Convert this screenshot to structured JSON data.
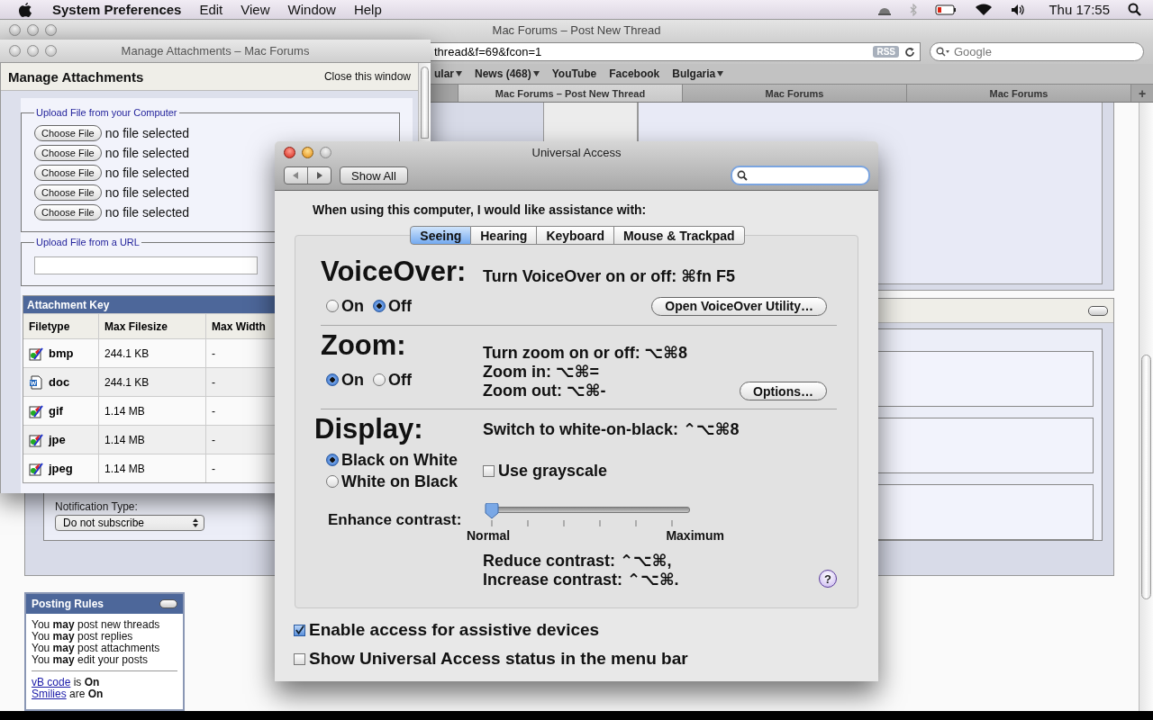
{
  "menu_bar": {
    "app_name": "System Preferences",
    "menus": [
      "Edit",
      "View",
      "Window",
      "Help"
    ],
    "clock": "Thu 17:55"
  },
  "browser": {
    "title": "Mac Forums – Post New Thread",
    "url": "thread&f=69&fcon=1",
    "rss": "RSS",
    "search_placeholder": "Google",
    "bookmarks": [
      {
        "label": "ular",
        "menu": true
      },
      {
        "label": "News (468)",
        "menu": true
      },
      {
        "label": "YouTube",
        "menu": false
      },
      {
        "label": "Facebook",
        "menu": false
      },
      {
        "label": "Bulgaria",
        "menu": true
      }
    ],
    "tabs": [
      {
        "label": "Mac Forums – Post New Thread",
        "selected": true
      },
      {
        "label": "Mac Forums",
        "selected": false
      },
      {
        "label": "Mac Forums",
        "selected": false
      }
    ],
    "new_tab": "+"
  },
  "forum_page": {
    "notification": {
      "label": "Notification Type:",
      "value": "Do not subscribe"
    },
    "posting_rules": {
      "title": "Posting Rules",
      "rules": [
        "You **may** post new threads",
        "You **may** post replies",
        "You **may** post attachments",
        "You **may** edit your posts"
      ],
      "settings": [
        {
          "link": "vB code",
          "verb": "is",
          "value": "On"
        },
        {
          "link": "Smilies",
          "verb": "are",
          "value": "On"
        }
      ]
    }
  },
  "attachments_window": {
    "title": "Manage Attachments – Mac Forums",
    "heading": "Manage Attachments",
    "close_link": "Close this window",
    "upload_computer": {
      "legend": "Upload File from your Computer",
      "rows": [
        {
          "button": "Choose File",
          "status": "no file selected"
        },
        {
          "button": "Choose File",
          "status": "no file selected"
        },
        {
          "button": "Choose File",
          "status": "no file selected"
        },
        {
          "button": "Choose File",
          "status": "no file selected"
        },
        {
          "button": "Choose File",
          "status": "no file selected"
        }
      ]
    },
    "upload_url": {
      "legend": "Upload File from a URL"
    },
    "attachment_key": {
      "title": "Attachment Key",
      "columns": [
        "Filetype",
        "Max Filesize",
        "Max Width"
      ],
      "rows": [
        {
          "kind": "image",
          "type": "bmp",
          "max_filesize": "244.1 KB",
          "max_width": "-"
        },
        {
          "kind": "document",
          "type": "doc",
          "max_filesize": "244.1 KB",
          "max_width": "-"
        },
        {
          "kind": "image",
          "type": "gif",
          "max_filesize": "1.14 MB",
          "max_width": "-"
        },
        {
          "kind": "image",
          "type": "jpe",
          "max_filesize": "1.14 MB",
          "max_width": "-"
        },
        {
          "kind": "image",
          "type": "jpeg",
          "max_filesize": "1.14 MB",
          "max_width": "-"
        }
      ]
    }
  },
  "universal_access": {
    "title": "Universal Access",
    "show_all": "Show All",
    "intro": "When using this computer, I would like assistance with:",
    "tabs": [
      {
        "label": "Seeing",
        "selected": true
      },
      {
        "label": "Hearing",
        "selected": false
      },
      {
        "label": "Keyboard",
        "selected": false
      },
      {
        "label": "Mouse & Trackpad",
        "selected": false
      }
    ],
    "voiceover": {
      "heading": "VoiceOver:",
      "shortcut": "Turn VoiceOver on or off: ⌘fn F5",
      "options": [
        {
          "label": "On",
          "selected": false
        },
        {
          "label": "Off",
          "selected": true
        }
      ],
      "button": "Open VoiceOver Utility…"
    },
    "zoom": {
      "heading": "Zoom:",
      "shortcuts": [
        "Turn zoom on or off: ⌥⌘8",
        "Zoom in: ⌥⌘=",
        "Zoom out: ⌥⌘-"
      ],
      "options": [
        {
          "label": "On",
          "selected": true
        },
        {
          "label": "Off",
          "selected": false
        }
      ],
      "button": "Options…"
    },
    "display": {
      "heading": "Display:",
      "shortcut": "Switch to white-on-black: ⌃⌥⌘8",
      "options": [
        {
          "label": "Black on White",
          "selected": true
        },
        {
          "label": "White on Black",
          "selected": false
        }
      ],
      "grayscale": {
        "label": "Use grayscale",
        "checked": false
      },
      "contrast": {
        "label": "Enhance contrast:",
        "level": 0,
        "min_label": "Normal",
        "max_label": "Maximum"
      },
      "contrast_shortcuts": [
        "Reduce contrast: ⌃⌥⌘,",
        "Increase contrast: ⌃⌥⌘."
      ]
    },
    "help": "?",
    "checkboxes": [
      {
        "label": "Enable access for assistive devices",
        "checked": true
      },
      {
        "label": "Show Universal Access status in the menu bar",
        "checked": false
      }
    ]
  }
}
